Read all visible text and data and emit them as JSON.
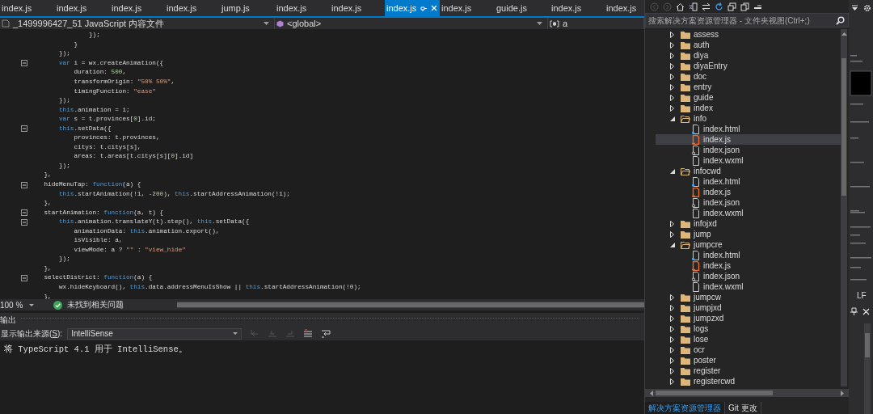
{
  "tabs": [
    {
      "label": "index.js",
      "selected": false
    },
    {
      "label": "index.js",
      "selected": false
    },
    {
      "label": "index.js",
      "selected": false
    },
    {
      "label": "index.js",
      "selected": false
    },
    {
      "label": "jump.js",
      "selected": false
    },
    {
      "label": "index.js",
      "selected": false
    },
    {
      "label": "index.js",
      "selected": false
    },
    {
      "label": "index.js",
      "selected": true
    },
    {
      "label": "index.js",
      "selected": false
    },
    {
      "label": "guide.js",
      "selected": false
    },
    {
      "label": "index.js",
      "selected": false
    },
    {
      "label": "index.js",
      "selected": false
    }
  ],
  "navigation_bar": {
    "project": "_1499996427_51 JavaScript 内容文件",
    "scope": "<global>",
    "member": "a"
  },
  "code_lines": [
    {
      "fold": false,
      "tokens": [
        {
          "kind": "plain",
          "text": "                });"
        }
      ]
    },
    {
      "fold": false,
      "tokens": [
        {
          "kind": "plain",
          "text": "            }"
        }
      ]
    },
    {
      "fold": false,
      "tokens": [
        {
          "kind": "plain",
          "text": "        });"
        }
      ]
    },
    {
      "fold": true,
      "tokens": [
        {
          "kind": "kw",
          "text": "        var"
        },
        {
          "kind": "plain",
          "text": " i = wx.createAnimation({"
        }
      ]
    },
    {
      "fold": false,
      "tokens": [
        {
          "kind": "plain",
          "text": "            duration: "
        },
        {
          "kind": "num",
          "text": "500"
        },
        {
          "kind": "plain",
          "text": ","
        }
      ]
    },
    {
      "fold": false,
      "tokens": [
        {
          "kind": "plain",
          "text": "            transformOrigin: "
        },
        {
          "kind": "str",
          "text": "\"50% 50%\""
        },
        {
          "kind": "plain",
          "text": ","
        }
      ]
    },
    {
      "fold": false,
      "tokens": [
        {
          "kind": "plain",
          "text": "            timingFunction: "
        },
        {
          "kind": "str",
          "text": "\"ease\""
        }
      ]
    },
    {
      "fold": false,
      "tokens": [
        {
          "kind": "plain",
          "text": "        });"
        }
      ]
    },
    {
      "fold": false,
      "tokens": [
        {
          "kind": "kw",
          "text": "        this"
        },
        {
          "kind": "plain",
          "text": ".animation = i;"
        }
      ]
    },
    {
      "fold": false,
      "tokens": [
        {
          "kind": "kw",
          "text": "        var"
        },
        {
          "kind": "plain",
          "text": " s = t.provinces["
        },
        {
          "kind": "num",
          "text": "0"
        },
        {
          "kind": "plain",
          "text": "].id;"
        }
      ]
    },
    {
      "fold": true,
      "tokens": [
        {
          "kind": "kw",
          "text": "        this"
        },
        {
          "kind": "plain",
          "text": ".setData({"
        }
      ]
    },
    {
      "fold": false,
      "tokens": [
        {
          "kind": "plain",
          "text": "            provinces: t.provinces,"
        }
      ]
    },
    {
      "fold": false,
      "tokens": [
        {
          "kind": "plain",
          "text": "            citys: t.citys[s],"
        }
      ]
    },
    {
      "fold": false,
      "tokens": [
        {
          "kind": "plain",
          "text": "            areas: t.areas[t.citys[s]["
        },
        {
          "kind": "num",
          "text": "0"
        },
        {
          "kind": "plain",
          "text": "].id]"
        }
      ]
    },
    {
      "fold": false,
      "tokens": [
        {
          "kind": "plain",
          "text": "        });"
        }
      ]
    },
    {
      "fold": false,
      "tokens": [
        {
          "kind": "plain",
          "text": "    },"
        }
      ]
    },
    {
      "fold": true,
      "tokens": [
        {
          "kind": "plain",
          "text": "    hideMenuTap: "
        },
        {
          "kind": "kw",
          "text": "function"
        },
        {
          "kind": "plain",
          "text": "(a) {"
        }
      ]
    },
    {
      "fold": false,
      "tokens": [
        {
          "kind": "kw",
          "text": "        this"
        },
        {
          "kind": "plain",
          "text": ".startAnimation(!1, "
        },
        {
          "kind": "num",
          "text": "-200"
        },
        {
          "kind": "plain",
          "text": "), "
        },
        {
          "kind": "kw",
          "text": "this"
        },
        {
          "kind": "plain",
          "text": ".startAddressAnimation(!1);"
        }
      ]
    },
    {
      "fold": false,
      "tokens": [
        {
          "kind": "plain",
          "text": "    },"
        }
      ]
    },
    {
      "fold": true,
      "tokens": [
        {
          "kind": "plain",
          "text": "    startAnimation: "
        },
        {
          "kind": "kw",
          "text": "function"
        },
        {
          "kind": "plain",
          "text": "(a, t) {"
        }
      ]
    },
    {
      "fold": true,
      "tokens": [
        {
          "kind": "kw",
          "text": "        this"
        },
        {
          "kind": "plain",
          "text": ".animation.translateY(t).step(), "
        },
        {
          "kind": "kw",
          "text": "this"
        },
        {
          "kind": "plain",
          "text": ".setData({"
        }
      ]
    },
    {
      "fold": false,
      "tokens": [
        {
          "kind": "plain",
          "text": "            animationData: "
        },
        {
          "kind": "kw",
          "text": "this"
        },
        {
          "kind": "plain",
          "text": ".animation.export(),"
        }
      ]
    },
    {
      "fold": false,
      "tokens": [
        {
          "kind": "plain",
          "text": "            isVisible: a,"
        }
      ]
    },
    {
      "fold": false,
      "tokens": [
        {
          "kind": "plain",
          "text": "            viewMode: a ? "
        },
        {
          "kind": "str",
          "text": "\"\""
        },
        {
          "kind": "plain",
          "text": " : "
        },
        {
          "kind": "str",
          "text": "\"view_hide\""
        }
      ]
    },
    {
      "fold": false,
      "tokens": [
        {
          "kind": "plain",
          "text": "        });"
        }
      ]
    },
    {
      "fold": false,
      "tokens": [
        {
          "kind": "plain",
          "text": "    },"
        }
      ]
    },
    {
      "fold": true,
      "tokens": [
        {
          "kind": "plain",
          "text": "    selectDistrict: "
        },
        {
          "kind": "kw",
          "text": "function"
        },
        {
          "kind": "plain",
          "text": "(a) {"
        }
      ]
    },
    {
      "fold": false,
      "tokens": [
        {
          "kind": "plain",
          "text": "        wx.hideKeyboard(), "
        },
        {
          "kind": "kw",
          "text": "this"
        },
        {
          "kind": "plain",
          "text": ".data.addressMenuIsShow || "
        },
        {
          "kind": "kw",
          "text": "this"
        },
        {
          "kind": "plain",
          "text": ".startAddressAnimation(!0);"
        }
      ]
    },
    {
      "fold": false,
      "tokens": [
        {
          "kind": "plain",
          "text": "    },"
        }
      ]
    }
  ],
  "status_bar": {
    "zoom": "100 %",
    "issues": "未找到相关问题"
  },
  "output_panel": {
    "title": "输出",
    "source_label": "显示输出来源(**S**):",
    "source": "IntelliSense",
    "text": "将 TypeScript 4.1 用于 IntelliSense。"
  },
  "solution_explorer": {
    "search": {
      "placeholder": "搜索解决方案资源管理器 - 文件夹视图(Ctrl+;)"
    },
    "items": [
      {
        "label": "assess",
        "kind": "folder",
        "expanded": false,
        "selected": false
      },
      {
        "label": "auth",
        "kind": "folder",
        "expanded": false,
        "selected": false
      },
      {
        "label": "diya",
        "kind": "folder",
        "expanded": false,
        "selected": false
      },
      {
        "label": "diyaEntry",
        "kind": "folder",
        "expanded": false,
        "selected": false
      },
      {
        "label": "doc",
        "kind": "folder",
        "expanded": false,
        "selected": false
      },
      {
        "label": "entry",
        "kind": "folder",
        "expanded": false,
        "selected": false
      },
      {
        "label": "guide",
        "kind": "folder",
        "expanded": false,
        "selected": false
      },
      {
        "label": "index",
        "kind": "folder",
        "expanded": false,
        "selected": false
      },
      {
        "label": "info",
        "kind": "folder",
        "expanded": true,
        "selected": false,
        "children": [
          {
            "label": "index.html",
            "kind": "html",
            "selected": false
          },
          {
            "label": "index.js",
            "kind": "js",
            "selected": true
          },
          {
            "label": "index.json",
            "kind": "json",
            "selected": false
          },
          {
            "label": "index.wxml",
            "kind": "wxml",
            "selected": false
          }
        ]
      },
      {
        "label": "infocwd",
        "kind": "folder",
        "expanded": true,
        "selected": false,
        "children": [
          {
            "label": "index.html",
            "kind": "html",
            "selected": false
          },
          {
            "label": "index.js",
            "kind": "js",
            "selected": false
          },
          {
            "label": "index.json",
            "kind": "json",
            "selected": false
          },
          {
            "label": "index.wxml",
            "kind": "wxml",
            "selected": false
          }
        ]
      },
      {
        "label": "infojxd",
        "kind": "folder",
        "expanded": false,
        "selected": false
      },
      {
        "label": "jump",
        "kind": "folder",
        "expanded": false,
        "selected": false
      },
      {
        "label": "jumpcre",
        "kind": "folder",
        "expanded": true,
        "selected": false,
        "children": [
          {
            "label": "index.html",
            "kind": "html",
            "selected": false
          },
          {
            "label": "index.js",
            "kind": "js",
            "selected": false
          },
          {
            "label": "index.json",
            "kind": "json",
            "selected": false
          },
          {
            "label": "index.wxml",
            "kind": "wxml",
            "selected": false
          }
        ]
      },
      {
        "label": "jumpcw",
        "kind": "folder",
        "expanded": false,
        "selected": false
      },
      {
        "label": "jumpjxd",
        "kind": "folder",
        "expanded": false,
        "selected": false
      },
      {
        "label": "jumpzxd",
        "kind": "folder",
        "expanded": false,
        "selected": false
      },
      {
        "label": "logs",
        "kind": "folder",
        "expanded": false,
        "selected": false
      },
      {
        "label": "lose",
        "kind": "folder",
        "expanded": false,
        "selected": false
      },
      {
        "label": "ocr",
        "kind": "folder",
        "expanded": false,
        "selected": false
      },
      {
        "label": "poster",
        "kind": "folder",
        "expanded": false,
        "selected": false
      },
      {
        "label": "register",
        "kind": "folder",
        "expanded": false,
        "selected": false
      },
      {
        "label": "registercwd",
        "kind": "folder",
        "expanded": false,
        "selected": false
      }
    ],
    "bottom_tabs": [
      {
        "label": "解决方案资源管理器",
        "selected": true
      },
      {
        "label": "Git 更改",
        "selected": false
      }
    ]
  },
  "side_strip": {
    "line_ending": "LF"
  }
}
